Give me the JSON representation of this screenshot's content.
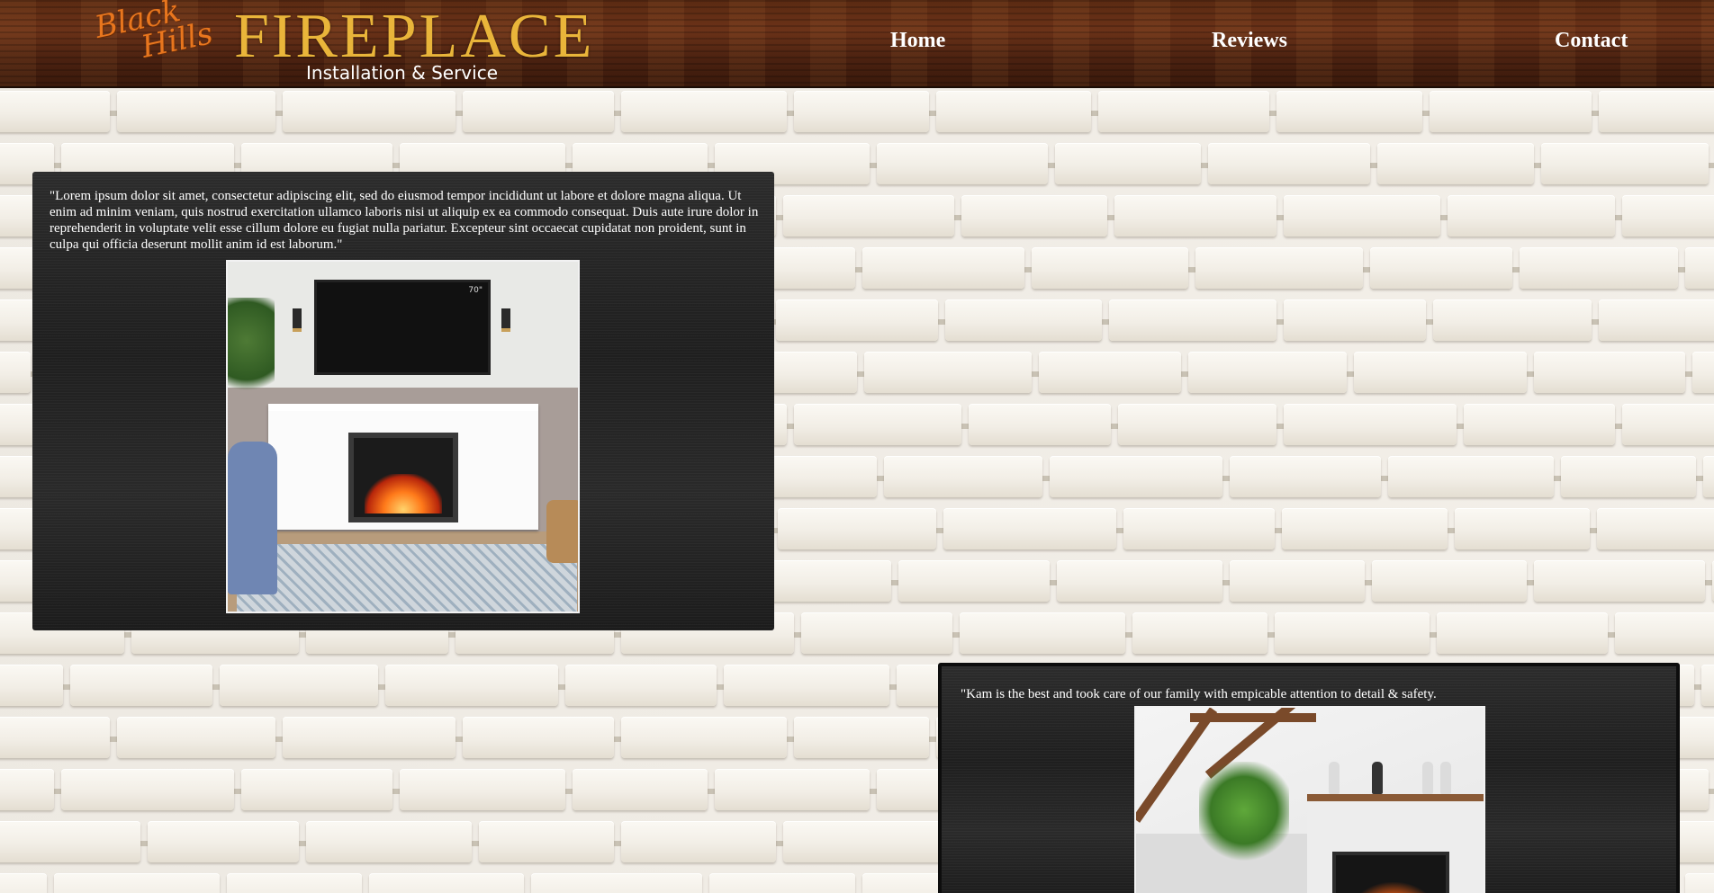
{
  "header": {
    "logo_script_line1": "Black",
    "logo_script_line2": "Hills",
    "logo_main": "FIREPLACE",
    "logo_sub": "Installation & Service",
    "nav": {
      "home": "Home",
      "reviews": "Reviews",
      "contact": "Contact"
    }
  },
  "reviews": [
    {
      "text": "\"Lorem ipsum dolor sit amet, consectetur adipiscing elit, sed do eiusmod tempor incididunt ut labore et dolore magna aliqua. Ut enim ad minim veniam, quis nostrud exercitation ullamco laboris nisi ut aliquip ex ea commodo consequat. Duis aute irure dolor in reprehenderit in voluptate velit esse cillum dolore eu fugiat nulla pariatur. Excepteur sint occaecat cupidatat non proident, sunt in culpa qui officia deserunt mollit anim id est laborum.\"",
      "photo_tv_label": "70\""
    },
    {
      "text": "\"Kam is the best and took care of our family with empicable attention to detail & safety."
    }
  ],
  "colors": {
    "header_wood": "#5a2a12",
    "logo_gold": "#e9b53a",
    "logo_orange": "#e8761e",
    "card_bg": "#242424",
    "brick_white": "#f2eee7"
  }
}
